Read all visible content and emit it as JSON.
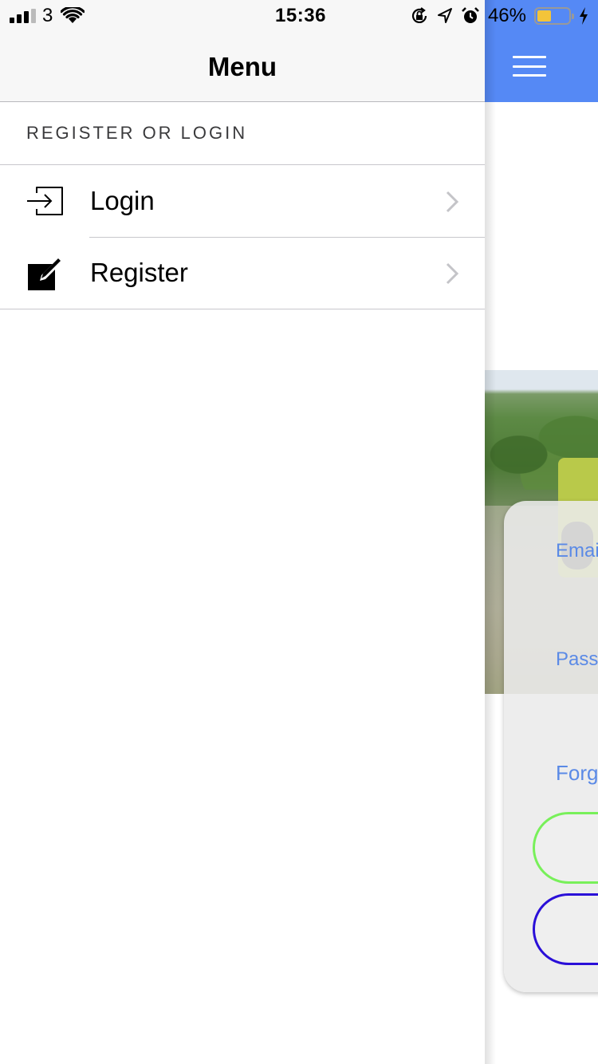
{
  "status_bar": {
    "carrier": "3",
    "time": "15:36",
    "battery_percent": "46%",
    "battery_level": 0.46,
    "battery_color": "#f3c43a",
    "icons": [
      "signal-icon",
      "wifi-icon",
      "orientation-lock-icon",
      "location-arrow-icon",
      "alarm-icon",
      "battery-icon",
      "charging-bolt-icon"
    ]
  },
  "menu": {
    "title": "Menu",
    "section_label": "REGISTER OR LOGIN",
    "items": [
      {
        "label": "Login",
        "icon": "login-arrow-icon"
      },
      {
        "label": "Register",
        "icon": "edit-pencil-icon"
      }
    ]
  },
  "background_screen": {
    "nav_color": "#5589f5",
    "menu_icon": "hamburger-icon",
    "email_label": "Emai",
    "password_label": "Pass",
    "forgot_link": "Forg",
    "login_button_border": "#78f05a",
    "register_button_border": "#2a0fd8",
    "link_color": "#5b8ae6"
  }
}
